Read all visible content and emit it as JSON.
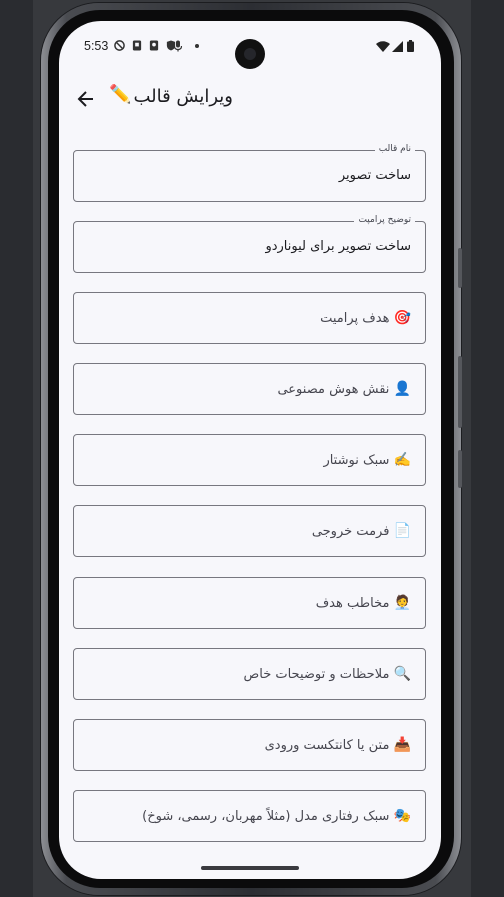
{
  "status_bar": {
    "time": "5:53"
  },
  "app_bar": {
    "title": "ویرایش قالب",
    "title_icon": "✏️",
    "back_icon": "arrow-back-icon"
  },
  "fields": [
    {
      "id": "template-name",
      "label": "نام قالب",
      "value": "ساخت تصویر"
    },
    {
      "id": "prompt-description",
      "label": "توضیح پرامپت",
      "value": "ساخت تصویر برای لیوناردو"
    },
    {
      "id": "prompt-goal",
      "placeholder_text": "هدف پرامیت",
      "emoji": "🎯"
    },
    {
      "id": "ai-role",
      "placeholder_text": "نقش هوش مصنوعی",
      "emoji": "👤"
    },
    {
      "id": "writing-style",
      "placeholder_text": "سبک نوشتار",
      "emoji": "✍️"
    },
    {
      "id": "output-format",
      "placeholder_text": "فرمت خروجی",
      "emoji": "📄"
    },
    {
      "id": "target-audience",
      "placeholder_text": "مخاطب هدف",
      "emoji": "🧑‍💼"
    },
    {
      "id": "notes",
      "placeholder_text": "ملاحظات و توضیحات خاص",
      "emoji": "🔍"
    },
    {
      "id": "input-context",
      "placeholder_text": "متن یا کانتکست ورودی",
      "emoji": "📥"
    },
    {
      "id": "model-behavior",
      "placeholder_text": "سبک رفتاری مدل (مثلاً مهربان، رسمی، شوخ)",
      "emoji": "🎭"
    }
  ],
  "colors": {
    "background": "#f7f7fb",
    "outline": "#77777f",
    "text": "#1b1b1f"
  }
}
